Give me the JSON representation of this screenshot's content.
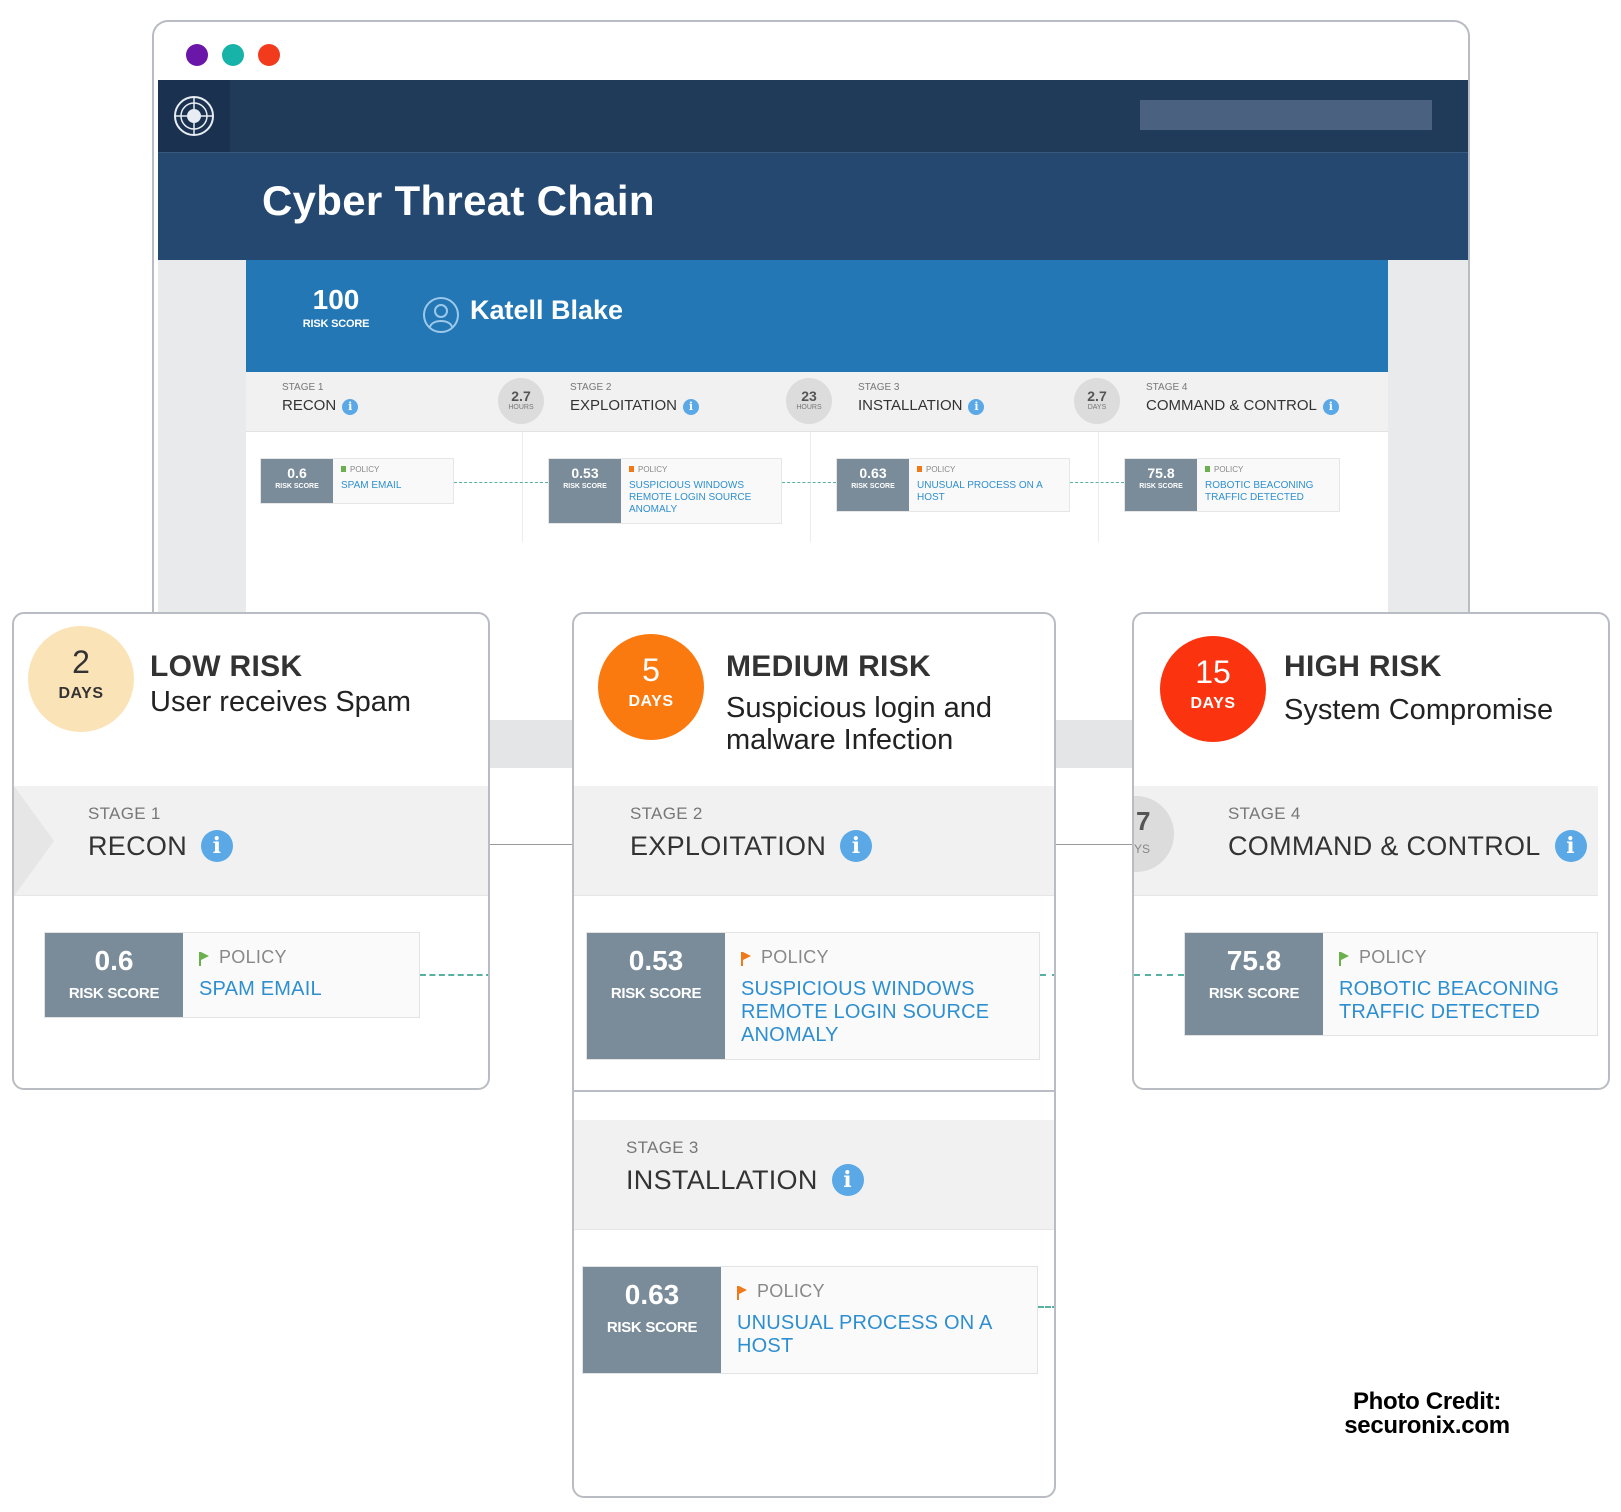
{
  "window": {
    "dots": [
      "#6a16a8",
      "#18b3a8",
      "#f23a1d"
    ]
  },
  "header": {
    "title": "Cyber Threat Chain"
  },
  "user": {
    "risk_score": "100",
    "risk_label": "RISK SCORE",
    "name": "Katell Blake"
  },
  "stages": [
    {
      "stage": "STAGE 1",
      "name": "RECON",
      "score": "0.6",
      "score_label": "RISK SCORE",
      "policy": "POLICY",
      "description": "SPAM EMAIL",
      "flag_color": "#6ab04c"
    },
    {
      "stage": "STAGE 2",
      "name": "EXPLOITATION",
      "score": "0.53",
      "score_label": "RISK SCORE",
      "policy": "POLICY",
      "description": "SUSPICIOUS WINDOWS REMOTE LOGIN SOURCE ANOMALY",
      "flag_color": "#f07a1a"
    },
    {
      "stage": "STAGE 3",
      "name": "INSTALLATION",
      "score": "0.63",
      "score_label": "RISK SCORE",
      "policy": "POLICY",
      "description": "UNUSUAL PROCESS ON A HOST",
      "flag_color": "#f07a1a"
    },
    {
      "stage": "STAGE 4",
      "name": "COMMAND & CONTROL",
      "score": "75.8",
      "score_label": "RISK SCORE",
      "policy": "POLICY",
      "description": "ROBOTIC BEACONING TRAFFIC DETECTED",
      "flag_color": "#6ab04c"
    }
  ],
  "durations": [
    {
      "value": "2.7",
      "unit": "HOURS"
    },
    {
      "value": "23",
      "unit": "HOURS"
    },
    {
      "value": "2.7",
      "unit": "DAYS"
    }
  ],
  "callouts": {
    "low": {
      "days": "2",
      "days_label": "DAYS",
      "title": "LOW RISK",
      "subtitle": "User receives Spam",
      "circle_color": "#fbe3b8",
      "text_color": "#333333"
    },
    "medium": {
      "days": "5",
      "days_label": "DAYS",
      "title": "MEDIUM RISK",
      "subtitle_line1": "Suspicious login and",
      "subtitle_line2": "malware Infection",
      "circle_color": "#fb7a0f",
      "text_color": "#ffffff"
    },
    "high": {
      "days": "15",
      "days_label": "DAYS",
      "title": "HIGH RISK",
      "subtitle": "System Compromise",
      "circle_color": "#fb330f",
      "text_color": "#ffffff",
      "peek_value": "7",
      "peek_unit": "YS"
    }
  },
  "credit": {
    "line1": "Photo Credit:",
    "line2": "securonix.com"
  }
}
